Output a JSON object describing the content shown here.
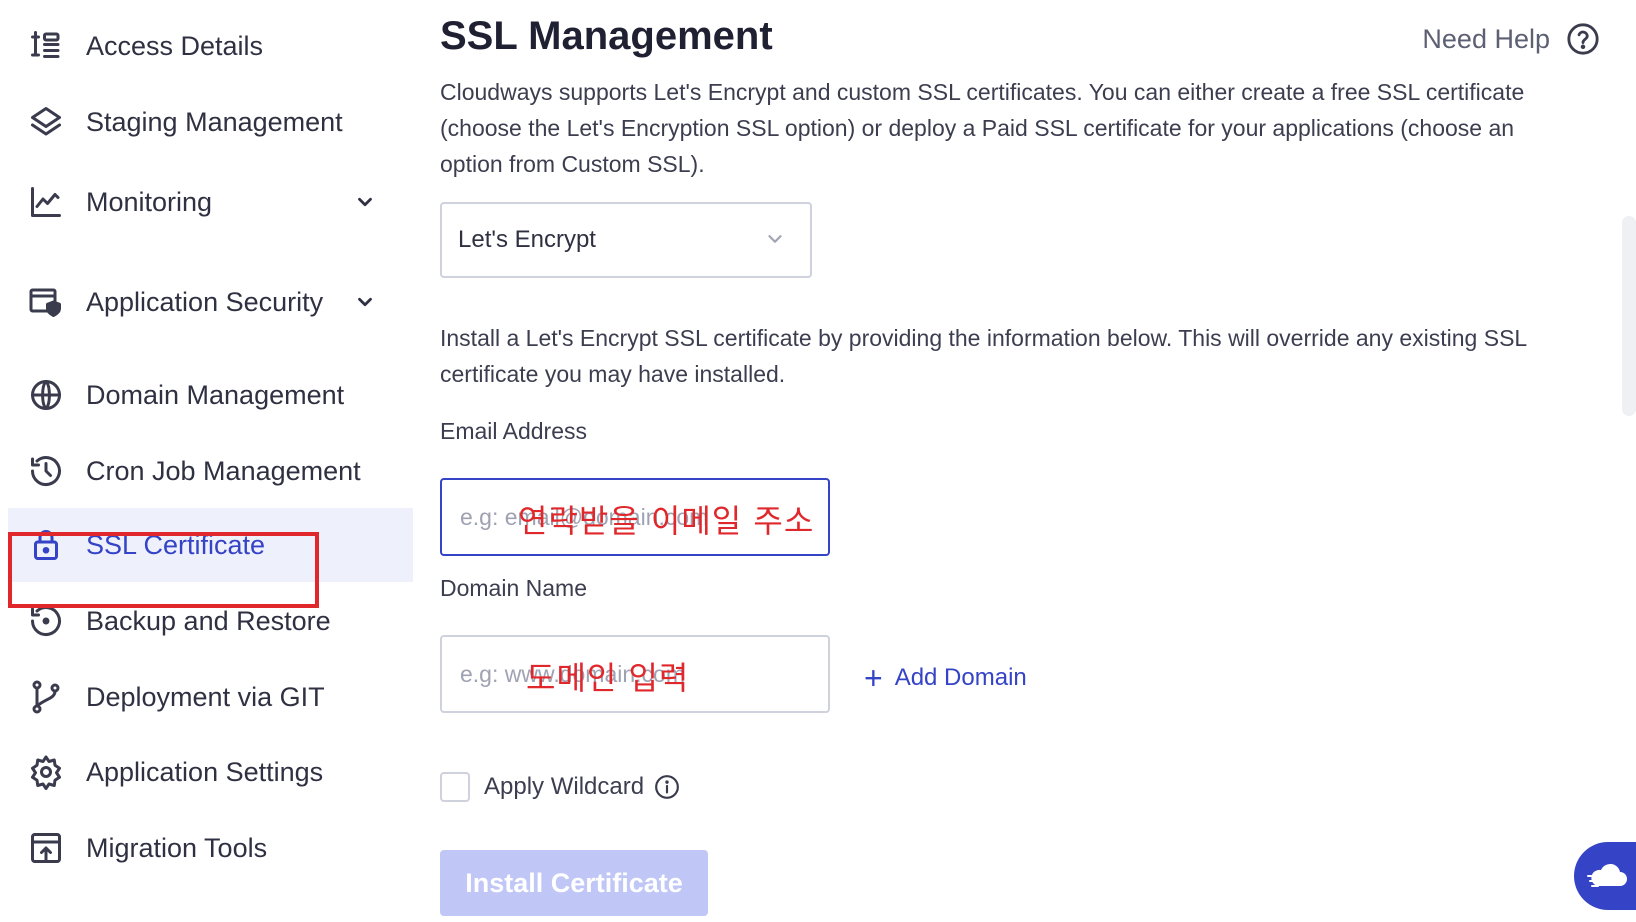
{
  "sidebar": {
    "items": [
      {
        "label": "Access Details",
        "icon": "access-details-icon",
        "has_chevron": false,
        "active": false
      },
      {
        "label": "Staging Management",
        "icon": "layers-icon",
        "has_chevron": false,
        "active": false
      },
      {
        "label": "Monitoring",
        "icon": "chart-line-icon",
        "has_chevron": true,
        "active": false
      },
      {
        "label": "Application Security",
        "icon": "shield-window-icon",
        "has_chevron": true,
        "active": false
      },
      {
        "label": "Domain Management",
        "icon": "www-globe-icon",
        "has_chevron": false,
        "active": false
      },
      {
        "label": "Cron Job Management",
        "icon": "history-clock-icon",
        "has_chevron": false,
        "active": false
      },
      {
        "label": "SSL Certificate",
        "icon": "lock-icon",
        "has_chevron": false,
        "active": true
      },
      {
        "label": "Backup and Restore",
        "icon": "restore-icon",
        "has_chevron": false,
        "active": false
      },
      {
        "label": "Deployment via GIT",
        "icon": "git-branch-icon",
        "has_chevron": false,
        "active": false
      },
      {
        "label": "Application Settings",
        "icon": "gear-icon",
        "has_chevron": false,
        "active": false
      },
      {
        "label": "Migration Tools",
        "icon": "migration-icon",
        "has_chevron": false,
        "active": false
      }
    ]
  },
  "main": {
    "title": "SSL Management",
    "help_label": "Need Help",
    "description": "Cloudways supports Let's Encrypt and custom SSL certificates. You can either create a free SSL certificate (choose the Let's Encryption SSL option) or deploy a Paid SSL certificate for your applications (choose an option from Custom SSL).",
    "ssl_type": {
      "selected": "Let's Encrypt"
    },
    "install_note": "Install a Let's Encrypt SSL certificate by providing the information below. This will override any existing SSL certificate you may have installed.",
    "email": {
      "label": "Email Address",
      "placeholder": "e.g: email@domain.com",
      "overlay_note": "연락받을 이메일 주소"
    },
    "domain": {
      "label": "Domain Name",
      "placeholder": "e.g: www.domain.com",
      "overlay_note": "도메인 입력"
    },
    "add_domain_label": "Add Domain",
    "wildcard_label": "Apply Wildcard",
    "install_button_label": "Install Certificate"
  },
  "colors": {
    "accent": "#3543c6",
    "annotation_red": "#e0282c",
    "disabled_button": "#c0c6f5",
    "active_nav_bg": "#eef0fb"
  }
}
